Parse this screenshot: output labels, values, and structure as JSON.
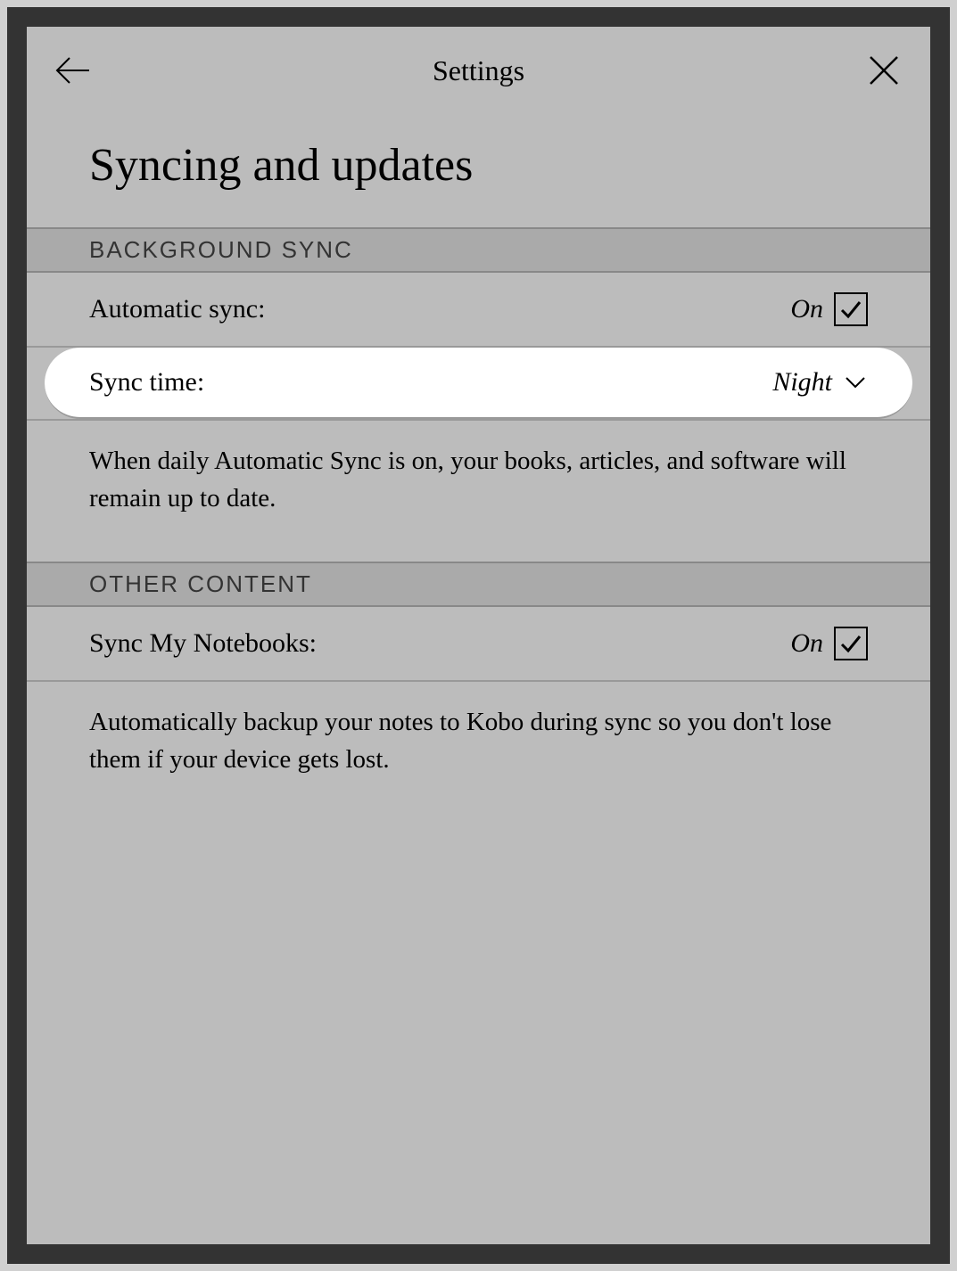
{
  "header": {
    "title": "Settings"
  },
  "page": {
    "title": "Syncing and updates"
  },
  "sections": {
    "background_sync": {
      "header": "BACKGROUND SYNC",
      "auto_sync": {
        "label": "Automatic sync:",
        "value": "On"
      },
      "sync_time": {
        "label": "Sync time:",
        "value": "Night"
      },
      "description": "When daily Automatic Sync is on, your books, articles, and software will remain up to date."
    },
    "other_content": {
      "header": "OTHER CONTENT",
      "sync_notebooks": {
        "label": "Sync My Notebooks:",
        "value": "On"
      },
      "description": "Automatically backup your notes to Kobo during sync so you don't lose them if your device gets lost."
    }
  }
}
